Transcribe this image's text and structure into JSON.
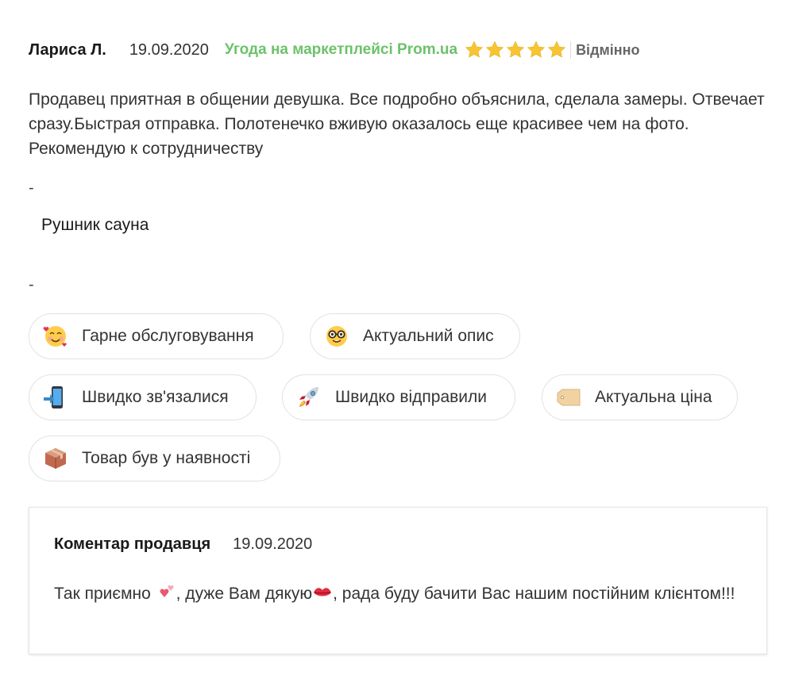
{
  "review": {
    "author": "Лариса Л.",
    "date": "19.09.2020",
    "deal_label": "Угода на маркетплейсі Prom.ua",
    "rating": 5,
    "rating_max": 5,
    "rating_label": "Відмінно",
    "text": "Продавец приятная в общении девушка. Все подробно объяснила, сделала замеры. Отвечает сразу.Быстрая отправка. Полотенечко вживую оказалось еще красивее чем на фото. Рекомендую к сотрудничеству",
    "separator_1": "-",
    "product_name": "Рушник сауна",
    "separator_2": "-"
  },
  "tags": [
    {
      "icon": "smiling-face-with-hearts-icon",
      "label": "Гарне обслуговування"
    },
    {
      "icon": "nerd-face-icon",
      "label": "Актуальний опис"
    },
    {
      "icon": "mobile-phone-arrow-icon",
      "label": "Швидко зв'язалися"
    },
    {
      "icon": "rocket-icon",
      "label": "Швидко відправили"
    },
    {
      "icon": "price-tag-icon",
      "label": "Актуальна ціна"
    },
    {
      "icon": "package-icon",
      "label": "Товар був у наявності"
    }
  ],
  "seller_comment": {
    "title": "Коментар продавця",
    "date": "19.09.2020",
    "text_part_1": "Так приємно ",
    "text_part_2": ", дуже Вам дякую",
    "text_part_3": ", рада буду бачити Вас нашим постійним клієнтом!!!"
  },
  "colors": {
    "deal_green": "#6cc26a",
    "star_gold": "#f7c531",
    "chip_border": "#e2e2e2"
  }
}
